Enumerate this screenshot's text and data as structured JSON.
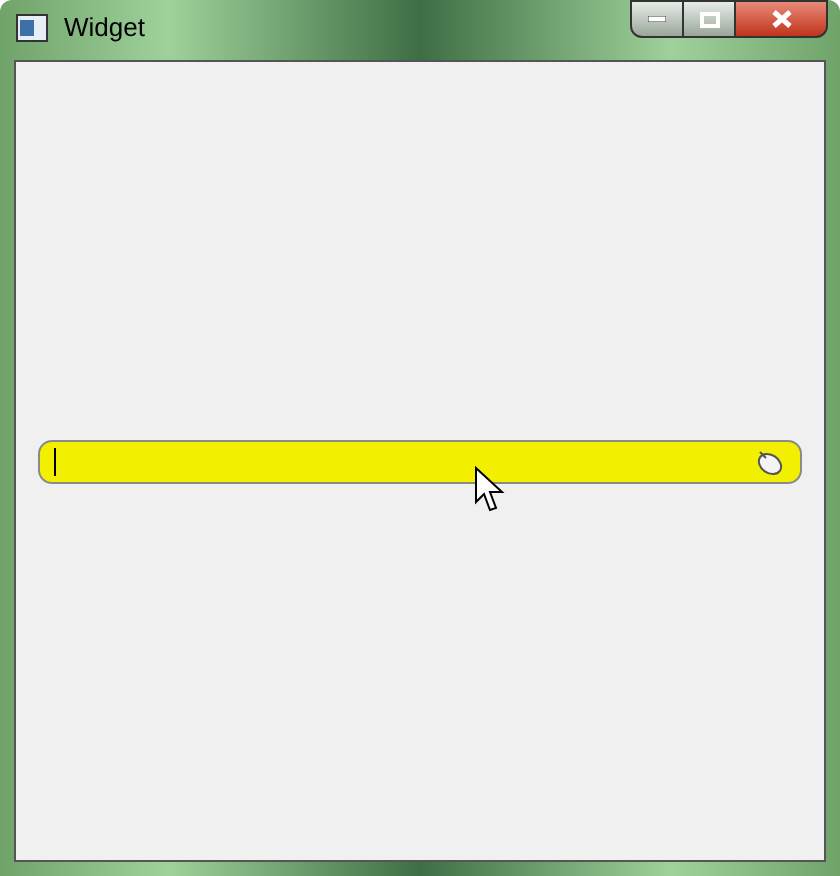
{
  "window": {
    "title": "Widget"
  },
  "field": {
    "focused": true
  }
}
